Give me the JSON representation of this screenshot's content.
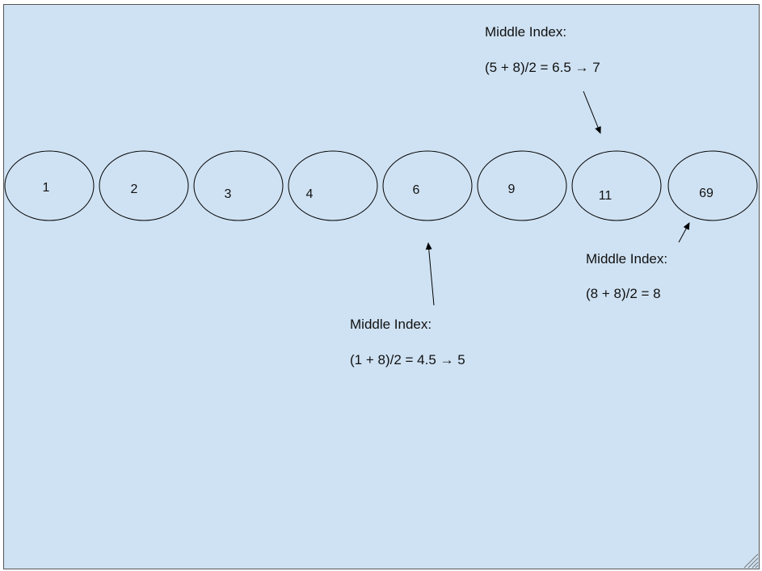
{
  "colors": {
    "background": "#cfe2f3",
    "stroke": "#000000",
    "text": "#111111"
  },
  "nodes": [
    {
      "value": "1"
    },
    {
      "value": "2"
    },
    {
      "value": "3"
    },
    {
      "value": "4"
    },
    {
      "value": "6"
    },
    {
      "value": "9"
    },
    {
      "value": "11"
    },
    {
      "value": "69"
    }
  ],
  "annotations": [
    {
      "heading": "Middle Index:",
      "formula": "(5 + 8)/2 = 6.5 → 7"
    },
    {
      "heading": "Middle Index:",
      "formula": "(1 + 8)/2 = 4.5 → 5"
    },
    {
      "heading": "Middle Index:",
      "formula": "(8 + 8)/2 = 8"
    }
  ],
  "icons": {
    "resize": "resize-grip-icon"
  }
}
